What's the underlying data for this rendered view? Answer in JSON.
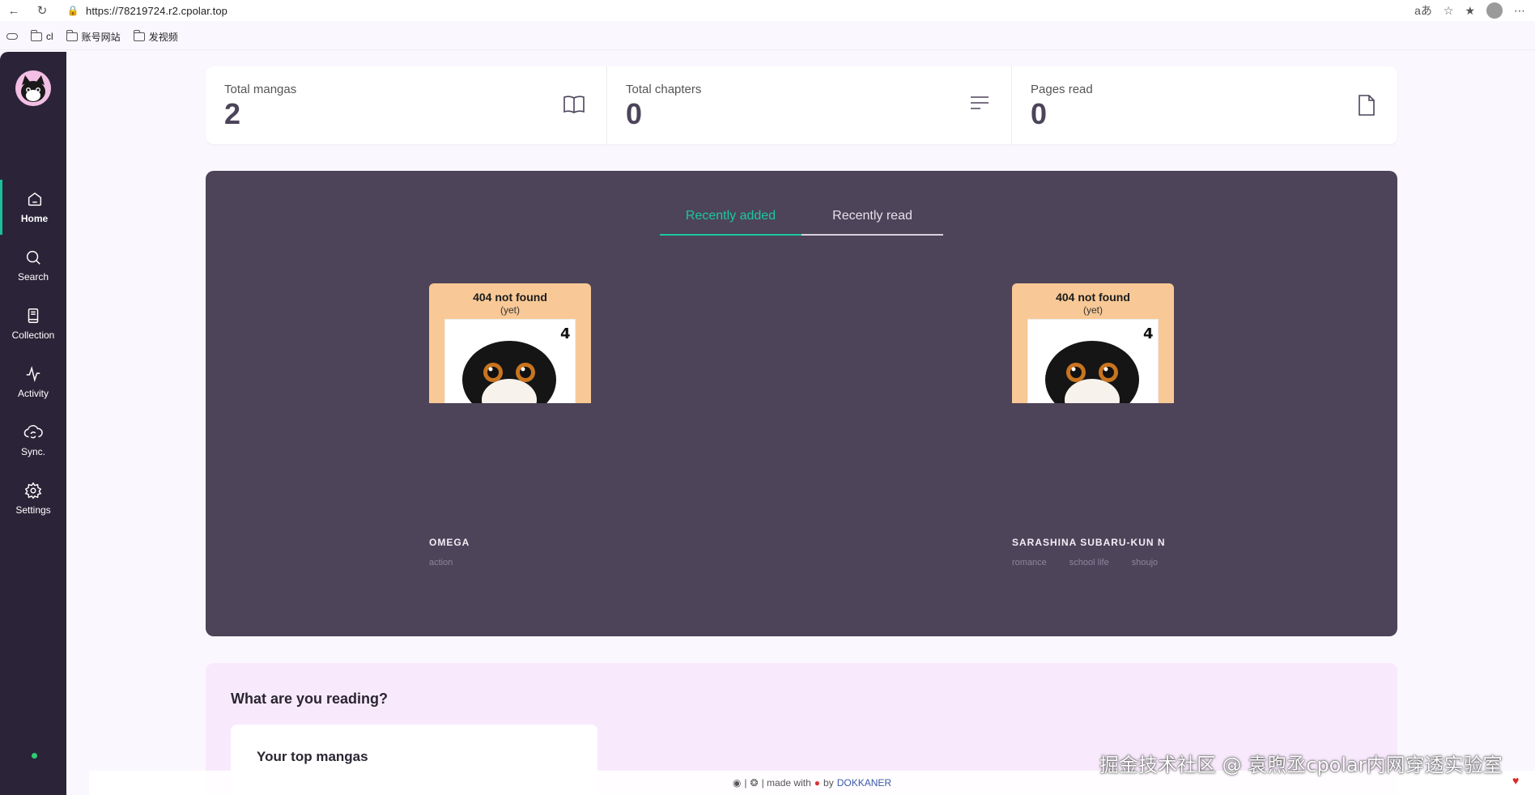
{
  "browser": {
    "url": "https://78219724.r2.cpolar.top",
    "bookmarks": [
      {
        "label": "cl"
      },
      {
        "label": "账号网站"
      },
      {
        "label": "发视频"
      }
    ]
  },
  "sidebar": {
    "items": [
      {
        "label": "Home",
        "icon": "home-icon",
        "active": true
      },
      {
        "label": "Search",
        "icon": "search-icon"
      },
      {
        "label": "Collection",
        "icon": "book-icon"
      },
      {
        "label": "Activity",
        "icon": "activity-icon"
      },
      {
        "label": "Sync.",
        "icon": "cloud-sync-icon"
      },
      {
        "label": "Settings",
        "icon": "gear-icon"
      }
    ],
    "status_color": "#2ecc71"
  },
  "stats": [
    {
      "label": "Total mangas",
      "value": "2",
      "icon": "open-book-icon"
    },
    {
      "label": "Total chapters",
      "value": "0",
      "icon": "lines-icon"
    },
    {
      "label": "Pages read",
      "value": "0",
      "icon": "file-icon"
    }
  ],
  "recent": {
    "tabs": [
      {
        "label": "Recently added",
        "active": true
      },
      {
        "label": "Recently read",
        "active": false
      }
    ],
    "mangas": [
      {
        "cover_title": "404 not found",
        "cover_sub": "(yet)",
        "name": "OMEGA",
        "tags": [
          "action"
        ]
      },
      {
        "cover_title": "404 not found",
        "cover_sub": "(yet)",
        "name": "SARASHINA SUBARU-KUN N",
        "tags": [
          "romance",
          "school life",
          "shoujo"
        ]
      }
    ]
  },
  "reading": {
    "title": "What are you reading?",
    "card_title": "Your top mangas"
  },
  "footer": {
    "text": "| made with",
    "by": "by",
    "link": "DOKKANER"
  },
  "watermark": "掘金技术社区 @ 袁煦丞cpolar内网穿透实验室",
  "colors": {
    "accent": "#1cc7a0",
    "sidebar_bg": "#2b2438",
    "panel_bg": "#4d4459"
  }
}
